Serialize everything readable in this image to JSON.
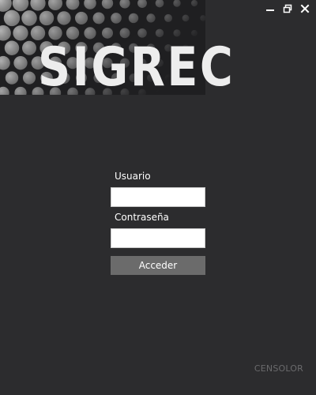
{
  "app": {
    "logo_text": "SIGREC",
    "footer_brand": "CENSOLOR"
  },
  "window_controls": {
    "minimize_icon": "minimize-icon",
    "restore_icon": "restore-icon",
    "close_icon": "close-icon"
  },
  "login": {
    "username_label": "Usuario",
    "username_value": "",
    "password_label": "Contraseña",
    "password_value": "",
    "submit_label": "Acceder"
  },
  "colors": {
    "background": "#2c2c2e",
    "button": "#6b6b6b",
    "footer_text": "#6a6a6c"
  }
}
